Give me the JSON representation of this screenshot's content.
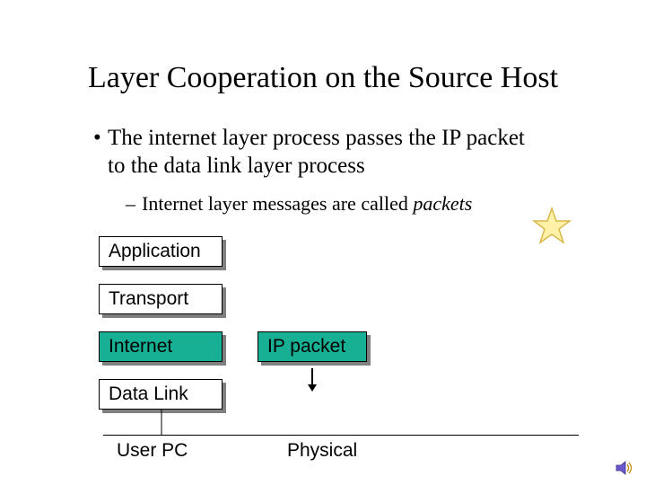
{
  "title": "Layer Cooperation on the Source Host",
  "bullet1_line1": "The internet layer process passes the IP packet",
  "bullet1_line2": "to the data link layer process",
  "bullet2_prefix": "Internet layer messages are called ",
  "bullet2_italic": "packets",
  "boxes": {
    "application": "Application",
    "transport": "Transport",
    "internet": "Internet",
    "datalink": "Data Link",
    "ip_packet": "IP packet"
  },
  "labels": {
    "user_pc": "User PC",
    "physical": "Physical"
  },
  "colors": {
    "teal": "#17b095",
    "shadow": "#808080",
    "star_fill": "#fff2a8",
    "star_stroke": "#d9b84a"
  }
}
